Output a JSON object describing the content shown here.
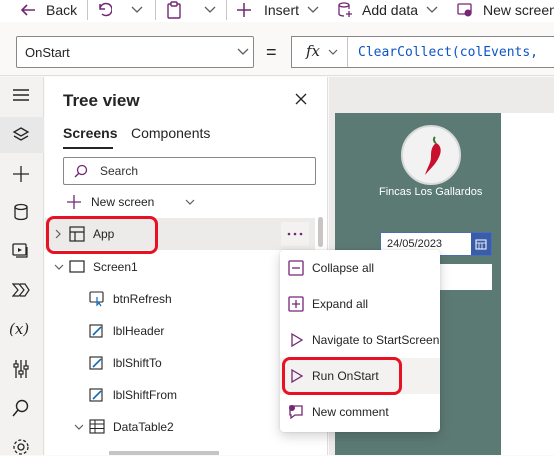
{
  "command_bar": {
    "back_label": "Back",
    "insert_label": "Insert",
    "add_data_label": "Add data",
    "new_screen_label": "New screen"
  },
  "formula_bar": {
    "property": "OnStart",
    "equals": "=",
    "fx_label": "fx",
    "formula": "ClearCollect(colEvents,"
  },
  "tree_view": {
    "title": "Tree view",
    "tabs": [
      "Screens",
      "Components"
    ],
    "active_tab": "Screens",
    "search_placeholder": "Search",
    "new_screen_label": "New screen",
    "nodes": [
      {
        "label": "App",
        "icon": "app-icon"
      },
      {
        "label": "Screen1",
        "icon": "screen-icon"
      },
      {
        "label": "btnRefresh",
        "icon": "button-icon"
      },
      {
        "label": "lblHeader",
        "icon": "label-edit-icon"
      },
      {
        "label": "lblShiftTo",
        "icon": "label-edit-icon"
      },
      {
        "label": "lblShiftFrom",
        "icon": "label-edit-icon"
      },
      {
        "label": "DataTable2",
        "icon": "table-icon"
      }
    ]
  },
  "canvas": {
    "brand_name": "Fincas Los Gallardos",
    "date_value": "24/05/2023",
    "background_color": "#5c7a74"
  },
  "context_menu": {
    "items": [
      {
        "label": "Collapse all",
        "icon": "collapse-icon"
      },
      {
        "label": "Expand all",
        "icon": "expand-icon"
      },
      {
        "label": "Navigate to StartScreen",
        "icon": "play-outline-icon"
      },
      {
        "label": "Run OnStart",
        "icon": "play-outline-icon"
      },
      {
        "label": "New comment",
        "icon": "comment-icon"
      }
    ],
    "highlighted": "Run OnStart"
  },
  "accent_colors": {
    "purple": "#742774",
    "annotation_red": "#e81123"
  }
}
